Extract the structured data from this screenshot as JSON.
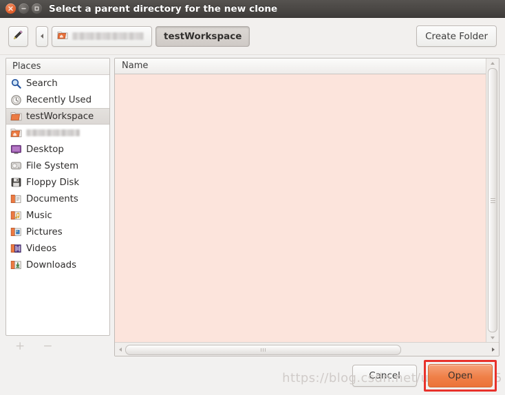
{
  "window": {
    "title": "Select a parent directory for the new clone",
    "controls": {
      "close": "close-button",
      "minimize": "minimize-button",
      "maximize": "maximize-button"
    }
  },
  "toolbar": {
    "edit_location_icon": "pencil-icon",
    "nav_back_icon": "chevron-left-icon",
    "breadcrumbs": [
      {
        "label": "",
        "blurred": true,
        "icon": "home-folder-icon",
        "active": false
      },
      {
        "label": "testWorkspace",
        "blurred": false,
        "icon": "",
        "active": true
      }
    ],
    "create_folder_label": "Create Folder"
  },
  "sidebar": {
    "header": "Places",
    "items": [
      {
        "label": "Search",
        "icon": "search-icon",
        "selected": false,
        "blurred": false
      },
      {
        "label": "Recently Used",
        "icon": "recent-clock-icon",
        "selected": false,
        "blurred": false
      },
      {
        "label": "testWorkspace",
        "icon": "folder-icon",
        "selected": true,
        "blurred": false
      },
      {
        "label": "",
        "icon": "home-folder-icon",
        "selected": false,
        "blurred": true
      },
      {
        "label": "Desktop",
        "icon": "desktop-icon",
        "selected": false,
        "blurred": false
      },
      {
        "label": "File System",
        "icon": "harddisk-icon",
        "selected": false,
        "blurred": false
      },
      {
        "label": "Floppy Disk",
        "icon": "floppy-icon",
        "selected": false,
        "blurred": false
      },
      {
        "label": "Documents",
        "icon": "documents-folder-icon",
        "selected": false,
        "blurred": false
      },
      {
        "label": "Music",
        "icon": "music-folder-icon",
        "selected": false,
        "blurred": false
      },
      {
        "label": "Pictures",
        "icon": "pictures-folder-icon",
        "selected": false,
        "blurred": false
      },
      {
        "label": "Videos",
        "icon": "videos-folder-icon",
        "selected": false,
        "blurred": false
      },
      {
        "label": "Downloads",
        "icon": "downloads-folder-icon",
        "selected": false,
        "blurred": false
      }
    ],
    "add_label": "+",
    "remove_label": "−"
  },
  "filelist": {
    "columns": [
      "Name"
    ],
    "rows": [],
    "empty": true
  },
  "footer": {
    "cancel_label": "Cancel",
    "open_label": "Open",
    "open_highlighted": true
  },
  "watermark": "https://blog.csdn.net/u011832525",
  "colors": {
    "titlebar": "#4b4845",
    "accent_orange": "#ef8048",
    "highlight_red": "#e8312b",
    "list_background": "#fce4dc",
    "window_background": "#f2f1f0"
  }
}
